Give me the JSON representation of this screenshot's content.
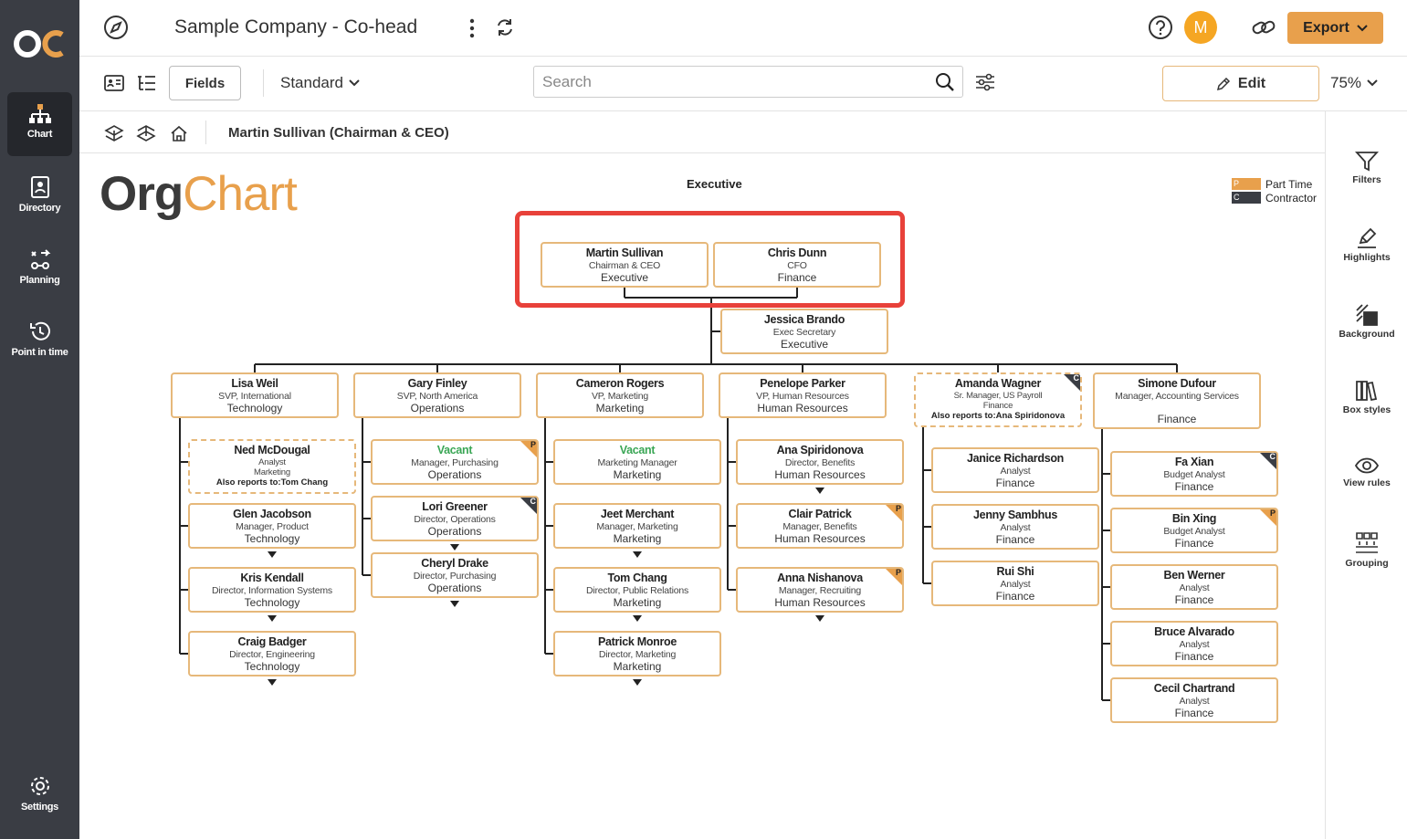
{
  "nav": {
    "items": [
      {
        "label": "Chart"
      },
      {
        "label": "Directory"
      },
      {
        "label": "Planning"
      },
      {
        "label": "Point in time"
      }
    ],
    "settings": "Settings"
  },
  "header": {
    "title": "Sample Company - Co-head",
    "avatar": "M",
    "export": "Export"
  },
  "toolbar": {
    "fields": "Fields",
    "view": "Standard",
    "search_placeholder": "Search",
    "edit": "Edit",
    "zoom": "75%"
  },
  "breadcrumb": "Martin Sullivan (Chairman & CEO)",
  "right_panel": [
    "Filters",
    "Highlights",
    "Background",
    "Box styles",
    "View rules",
    "Grouping"
  ],
  "chart": {
    "brand_a": "Org",
    "brand_b": "Chart",
    "section": "Executive",
    "legend": [
      {
        "code": "P",
        "label": "Part Time",
        "color": "#e8a04c"
      },
      {
        "code": "C",
        "label": "Contractor",
        "color": "#3a3d44"
      }
    ],
    "heads": [
      {
        "name": "Martin Sullivan",
        "title": "Chairman & CEO",
        "dept": "Executive"
      },
      {
        "name": "Chris  Dunn",
        "title": "CFO",
        "dept": "Finance"
      }
    ],
    "assistant": {
      "name": "Jessica Brando",
      "title": "Exec Secretary",
      "dept": "Executive"
    },
    "columns": [
      {
        "head": {
          "name": "Lisa Weil",
          "title": "SVP, International",
          "dept": "Technology"
        },
        "reports": [
          {
            "name": "Ned McDougal",
            "title": "Analyst",
            "dept": "Marketing",
            "also": "Also reports to:Tom Chang",
            "dashed": true
          },
          {
            "name": "Glen Jacobson",
            "title": "Manager, Product",
            "dept": "Technology",
            "more": true
          },
          {
            "name": "Kris Kendall",
            "title": "Director, Information Systems",
            "dept": "Technology",
            "more": true
          },
          {
            "name": "Craig Badger",
            "title": "Director, Engineering",
            "dept": "Technology",
            "more": true
          }
        ]
      },
      {
        "head": {
          "name": "Gary Finley",
          "title": "SVP, North America",
          "dept": "Operations"
        },
        "reports": [
          {
            "name": "Vacant",
            "title": "Manager, Purchasing",
            "dept": "Operations",
            "vacant": true,
            "badge": "P"
          },
          {
            "name": "Lori Greener",
            "title": "Director, Operations",
            "dept": "Operations",
            "badge": "C",
            "more": true
          },
          {
            "name": "Cheryl Drake",
            "title": "Director, Purchasing",
            "dept": "Operations",
            "more": true
          }
        ]
      },
      {
        "head": {
          "name": "Cameron Rogers",
          "title": "VP, Marketing",
          "dept": "Marketing"
        },
        "reports": [
          {
            "name": "Vacant",
            "title": "Marketing Manager",
            "dept": "Marketing",
            "vacant": true
          },
          {
            "name": "Jeet Merchant",
            "title": "Manager, Marketing",
            "dept": "Marketing",
            "more": true
          },
          {
            "name": "Tom Chang",
            "title": "Director, Public Relations",
            "dept": "Marketing",
            "more": true
          },
          {
            "name": "Patrick Monroe",
            "title": "Director, Marketing",
            "dept": "Marketing",
            "more": true
          }
        ]
      },
      {
        "head": {
          "name": "Penelope Parker",
          "title": "VP, Human Resources",
          "dept": "Human Resources"
        },
        "reports": [
          {
            "name": "Ana Spiridonova",
            "title": "Director, Benefits",
            "dept": "Human Resources",
            "more": true
          },
          {
            "name": "Clair Patrick",
            "title": "Manager, Benefits",
            "dept": "Human Resources",
            "badge": "P"
          },
          {
            "name": "Anna Nishanova",
            "title": "Manager, Recruiting",
            "dept": "Human Resources",
            "badge": "P",
            "more": true
          }
        ]
      },
      {
        "head": {
          "name": "Amanda Wagner",
          "title": "Sr. Manager, US Payroll",
          "dept": "Finance",
          "also": "Also reports to:Ana Spiridonova",
          "dashed": true,
          "badge": "C"
        },
        "reports": [
          {
            "name": "Janice Richardson",
            "title": "Analyst",
            "dept": "Finance"
          },
          {
            "name": "Jenny Sambhus",
            "title": "Analyst",
            "dept": "Finance"
          },
          {
            "name": "Rui Shi",
            "title": "Analyst",
            "dept": "Finance"
          }
        ]
      },
      {
        "head": {
          "name": "Simone Dufour",
          "title": "Manager, Accounting Services",
          "dept": "Finance"
        },
        "reports": [
          {
            "name": "Fa Xian",
            "title": "Budget Analyst",
            "dept": "Finance",
            "badge": "C"
          },
          {
            "name": "Bin Xing",
            "title": "Budget Analyst",
            "dept": "Finance",
            "badge": "P"
          },
          {
            "name": "Ben Werner",
            "title": "Analyst",
            "dept": "Finance"
          },
          {
            "name": "Bruce Alvarado",
            "title": "Analyst",
            "dept": "Finance"
          },
          {
            "name": "Cecil Chartrand",
            "title": "Analyst",
            "dept": "Finance"
          }
        ]
      }
    ]
  }
}
